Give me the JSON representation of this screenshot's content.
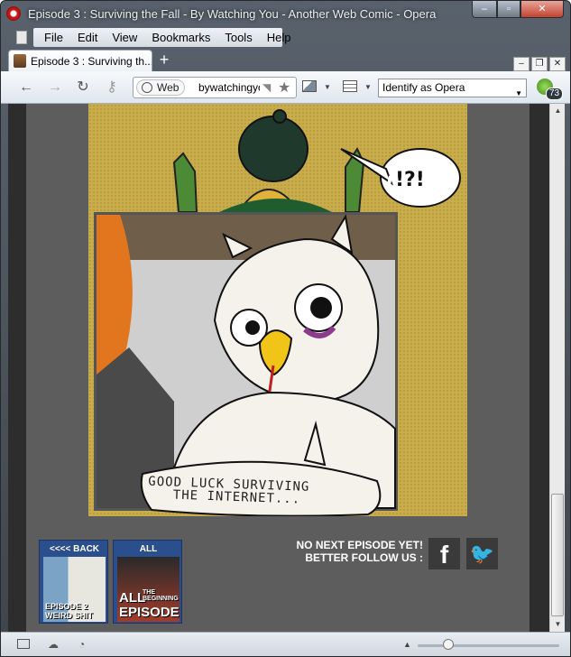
{
  "window": {
    "title": "Episode 3 : Surviving the Fall - By Watching You - Another Web Comic - Opera",
    "controls": {
      "minimize": "–",
      "maximize": "▫",
      "close": "✕"
    }
  },
  "menu": {
    "items": [
      "File",
      "Edit",
      "View",
      "Bookmarks",
      "Tools",
      "Help"
    ],
    "mdi": {
      "minimize": "–",
      "restore": "❐",
      "close": "✕"
    }
  },
  "tabs": [
    {
      "label": "Episode 3 : Surviving th...",
      "active": true
    }
  ],
  "new_tab": "+",
  "nav": {
    "back": "←",
    "forward": "→",
    "reload": "↻",
    "key": "⚷",
    "web_label": "Web",
    "url": "bywatchingyou.com",
    "feed": "◥",
    "bookmark": "★",
    "identify": "Identify as Opera",
    "unite_count": "73"
  },
  "comic": {
    "speech": "!?!",
    "caption_line1": "GOOD LUCK SURVIVING",
    "caption_line2": "THE INTERNET..."
  },
  "footer": {
    "back_label": "<<<< BACK",
    "back_caption_line1": "EPISODE 2",
    "back_caption_line2": "WEIRD SHIT",
    "all_label": "ALL",
    "all_caption_line1": "ALL",
    "all_caption_line2": "EPISODES",
    "all_sub": "THE BEGINNING",
    "follow_line1": "NO NEXT EPISODE YET!",
    "follow_line2": "BETTER FOLLOW US :",
    "facebook": "f",
    "twitter": "🐦"
  },
  "status": {
    "zoom_level": 0.18
  },
  "colors": {
    "page_bg": "#5d5d5d",
    "comic_bg": "#c9ad4c",
    "thumb_bg": "#2b4e8c"
  }
}
